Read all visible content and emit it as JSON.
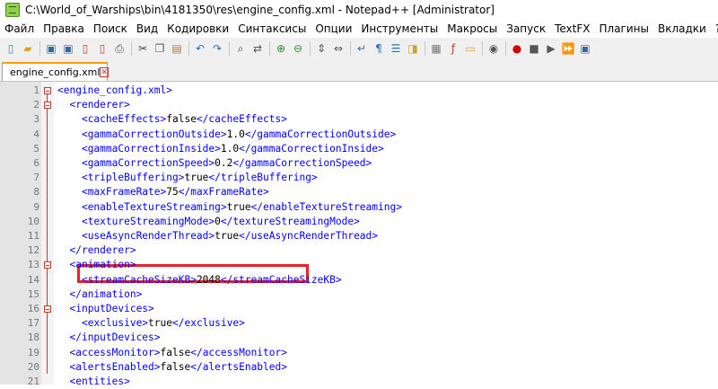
{
  "window": {
    "title": "C:\\World_of_Warships\\bin\\4181350\\res\\engine_config.xml - Notepad++ [Administrator]"
  },
  "menu": [
    "Файл",
    "Правка",
    "Поиск",
    "Вид",
    "Кодировки",
    "Синтаксисы",
    "Опции",
    "Инструменты",
    "Макросы",
    "Запуск",
    "TextFX",
    "Плагины",
    "Вкладки",
    "?"
  ],
  "toolbar": {
    "icons": [
      "new-file-icon",
      "open-file-icon",
      "save-icon",
      "save-all-icon",
      "close-icon",
      "close-all-icon",
      "print-icon",
      "cut-icon",
      "copy-icon",
      "paste-icon",
      "undo-icon",
      "redo-icon",
      "find-icon",
      "replace-icon",
      "zoom-in-icon",
      "zoom-out-icon",
      "sync-vertical-icon",
      "sync-horizontal-icon",
      "word-wrap-icon",
      "show-all-chars-icon",
      "indent-guide-icon",
      "user-lang-icon",
      "doc-map-icon",
      "function-list-icon",
      "folder-workspace-icon",
      "monitor-icon",
      "record-macro-icon",
      "stop-macro-icon",
      "play-macro-icon",
      "run-macro-multiple-icon",
      "save-macro-icon"
    ]
  },
  "tab": {
    "label": "engine_config.xml"
  },
  "highlight_color": "#e8202a",
  "lines": [
    {
      "n": "1",
      "text": "<engine_config.xml>"
    },
    {
      "n": "2",
      "text": "  <renderer>"
    },
    {
      "n": "3",
      "text": "    <cacheEffects>false</cacheEffects>"
    },
    {
      "n": "4",
      "text": "    <gammaCorrectionOutside>1.0</gammaCorrectionOutside>"
    },
    {
      "n": "5",
      "text": "    <gammaCorrectionInside>1.0</gammaCorrectionInside>"
    },
    {
      "n": "6",
      "text": "    <gammaCorrectionSpeed>0.2</gammaCorrectionSpeed>"
    },
    {
      "n": "7",
      "text": "    <tripleBuffering>true</tripleBuffering>"
    },
    {
      "n": "8",
      "text": "    <maxFrameRate>75</maxFrameRate>"
    },
    {
      "n": "9",
      "text": "    <enableTextureStreaming>true</enableTextureStreaming>"
    },
    {
      "n": "10",
      "text": "    <textureStreamingMode>0</textureStreamingMode>"
    },
    {
      "n": "11",
      "text": "    <useAsyncRenderThread>true</useAsyncRenderThread>"
    },
    {
      "n": "12",
      "text": "  </renderer>"
    },
    {
      "n": "13",
      "text": "  <animation>"
    },
    {
      "n": "14",
      "text": "    <streamCacheSizeKB>2048</streamCacheSizeKB>"
    },
    {
      "n": "15",
      "text": "  </animation>"
    },
    {
      "n": "16",
      "text": "  <inputDevices>"
    },
    {
      "n": "17",
      "text": "    <exclusive>true</exclusive>"
    },
    {
      "n": "18",
      "text": "  </inputDevices>"
    },
    {
      "n": "19",
      "text": "  <accessMonitor>false</accessMonitor>"
    },
    {
      "n": "20",
      "text": "  <alertsEnabled>false</alertsEnabled>"
    },
    {
      "n": "21",
      "text": "  <entities>"
    }
  ]
}
